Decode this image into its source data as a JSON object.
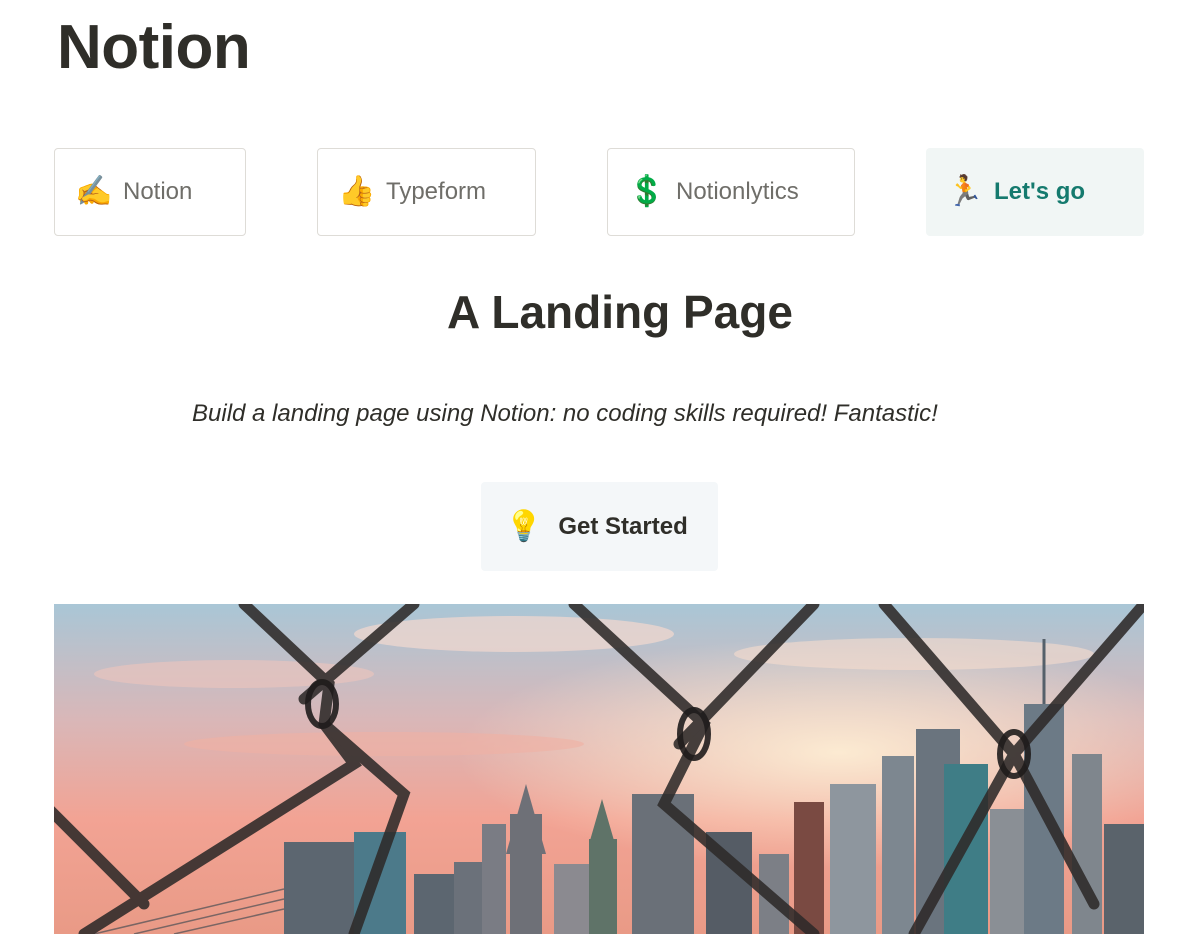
{
  "page": {
    "title": "Notion"
  },
  "nav": [
    {
      "icon": "writing-hand-icon",
      "glyph": "✍️",
      "label": "Notion"
    },
    {
      "icon": "thumbs-up-icon",
      "glyph": "👍",
      "label": "Typeform"
    },
    {
      "icon": "dollar-sign-icon",
      "glyph": "💲",
      "label": "Notionlytics"
    },
    {
      "icon": "runner-icon",
      "glyph": "🏃",
      "label": "Let's go",
      "accent": "#157a6e"
    }
  ],
  "hero_text": {
    "headline": "A Landing Page",
    "subtitle": "Build a landing page using Notion: no coding skills required! Fantastic!"
  },
  "cta": {
    "icon": "light-bulb-icon",
    "glyph": "💡",
    "label": "Get Started"
  },
  "colors": {
    "text": "#2f2e29",
    "muted": "#6f6e69",
    "accent": "#157a6e",
    "accent_bg": "#f1f6f5",
    "cta_bg": "#f4f7f9"
  }
}
